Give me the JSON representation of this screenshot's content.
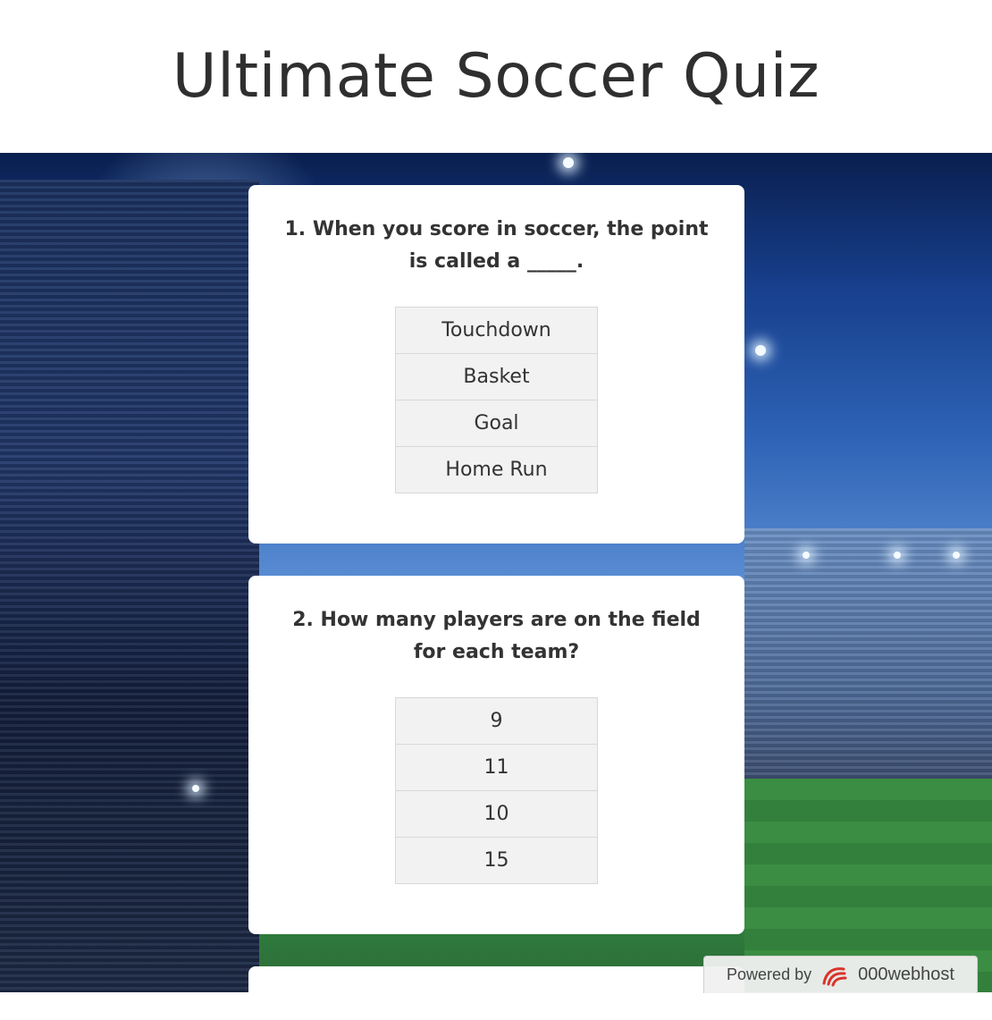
{
  "header": {
    "title": "Ultimate Soccer Quiz"
  },
  "questions": [
    {
      "text": "1. When you score in soccer, the point is called a _____.",
      "options": [
        "Touchdown",
        "Basket",
        "Goal",
        "Home Run"
      ]
    },
    {
      "text": "2. How many players are on the field for each team?",
      "options": [
        "9",
        "11",
        "10",
        "15"
      ]
    }
  ],
  "footer_badge": {
    "powered_label": "Powered by",
    "brand": "000webhost",
    "icon": "000webhost-logo-icon"
  },
  "colors": {
    "title": "#2f2f2f",
    "option_bg": "#f2f2f2",
    "card_bg": "#ffffff",
    "stadium_blue": "#2e63b6"
  }
}
